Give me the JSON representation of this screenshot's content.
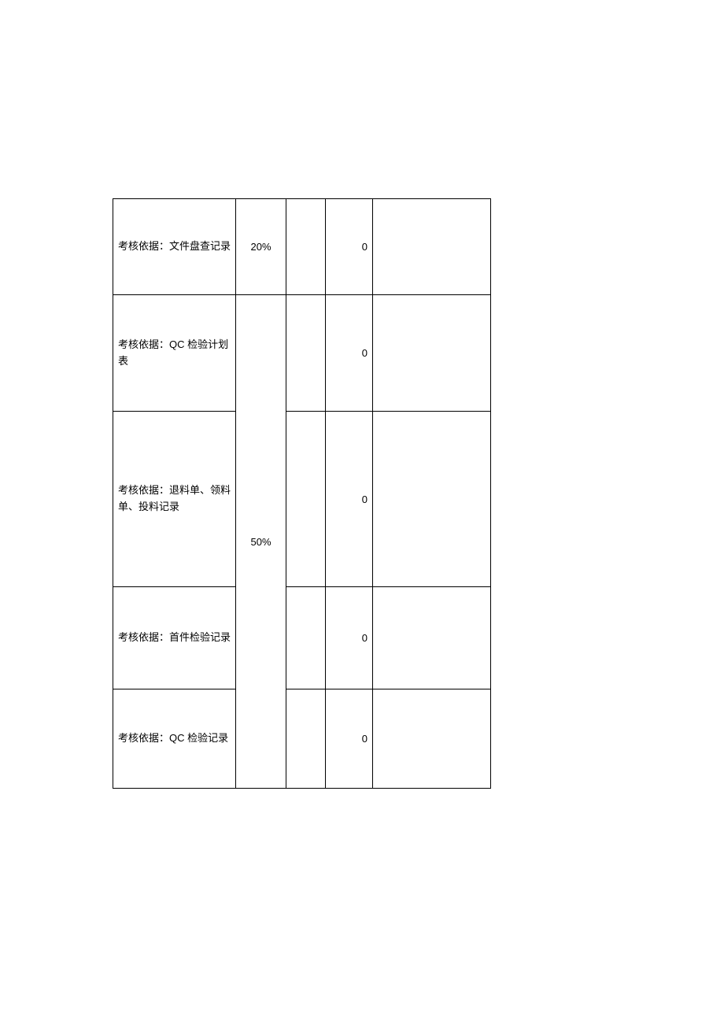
{
  "rows": [
    {
      "basis": "考核依据：文件盘查记录",
      "pct": "20%",
      "score": "0"
    },
    {
      "basis": "考核依据：QC 检验计划表",
      "pct": "50%",
      "score": "0"
    },
    {
      "basis": "考核依据：退料单、领料单、投料记录",
      "pct": "",
      "score": "0"
    },
    {
      "basis": "考核依据：首件检验记录",
      "pct": "",
      "score": "0"
    },
    {
      "basis": "考核依据：QC 检验记录",
      "pct": "",
      "score": "0"
    }
  ]
}
